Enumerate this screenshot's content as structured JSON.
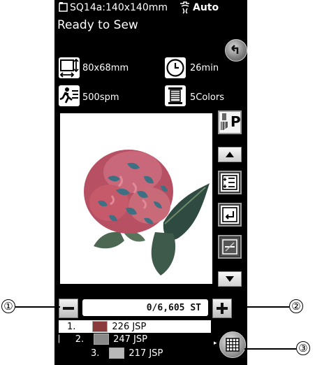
{
  "header": {
    "hoop_label": "SQ14a:140x140mm",
    "thread_cutter_label": "Auto"
  },
  "status_text": "Ready to Sew",
  "info": {
    "size": "80x68mm",
    "time": "26min",
    "speed": "500spm",
    "colors": "5Colors"
  },
  "presser_foot_label": "P",
  "stitch_counter": "0/6,605 ST",
  "color_list": [
    {
      "index": "1.",
      "value": "226 JSP",
      "swatch": "#8a3a3a"
    },
    {
      "index": "2.",
      "value": "247 JSP",
      "swatch": "#8a8a8a"
    },
    {
      "index": "3.",
      "value": "217 JSP",
      "swatch": "#b8b8b8"
    }
  ],
  "callouts": [
    "①",
    "②",
    "③"
  ],
  "colors": {
    "screen_bg": "#000000",
    "flower_petal": "#c65a6a",
    "flower_petal_dark": "#3d7082",
    "leaf_dark": "#2f4a40",
    "leaf_light": "#6c8a6a"
  }
}
